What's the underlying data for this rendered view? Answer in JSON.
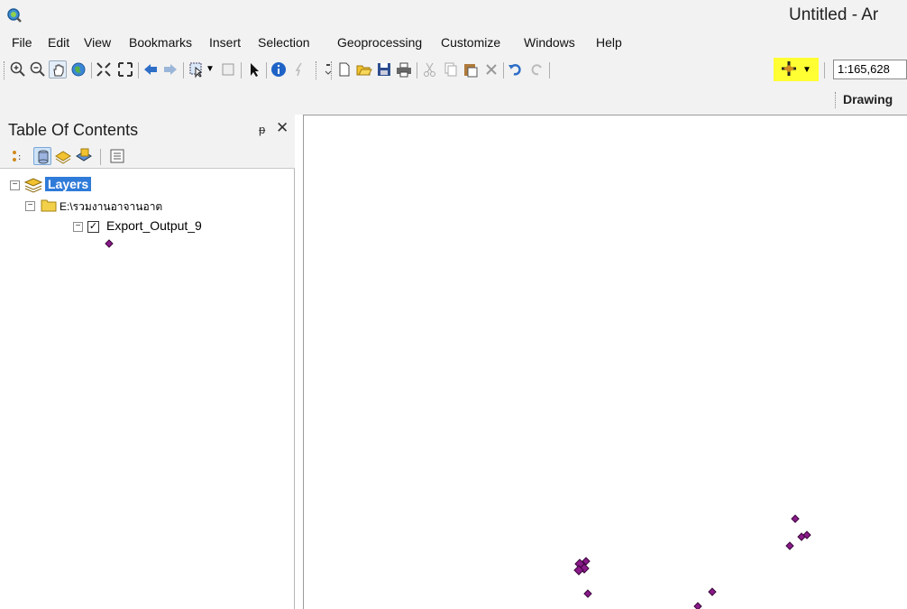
{
  "window": {
    "title": "Untitled - Ar"
  },
  "menu": {
    "items": [
      "File",
      "Edit",
      "View",
      "Bookmarks",
      "Insert",
      "Selection",
      "Geoprocessing",
      "Customize",
      "Windows",
      "Help"
    ]
  },
  "toolbar": {
    "scale_value": "1:165,628",
    "icons": [
      "zoom-in-icon",
      "zoom-out-icon",
      "pan-icon",
      "full-extent-icon",
      "fixed-zoom-in-icon",
      "fixed-zoom-out-icon",
      "back-icon",
      "forward-icon",
      "select-features-icon",
      "clear-selection-icon",
      "select-elements-icon",
      "identify-icon",
      "hyperlink-icon",
      "new-icon",
      "open-icon",
      "save-icon",
      "print-icon",
      "cut-icon",
      "copy-icon",
      "paste-icon",
      "delete-icon",
      "undo-icon",
      "redo-icon",
      "add-data-icon"
    ],
    "highlight_color": "#ffff33"
  },
  "drawing_toolbar": {
    "label": "Drawing"
  },
  "toc": {
    "title": "Table Of Contents",
    "layers_label": "Layers",
    "folder_label": "E:\\รวมงานอาจานอาต",
    "layer_name": "Export_Output_9",
    "symbol_color": "#8b1a8b"
  },
  "map": {
    "point_color": "#8b1a8b"
  }
}
